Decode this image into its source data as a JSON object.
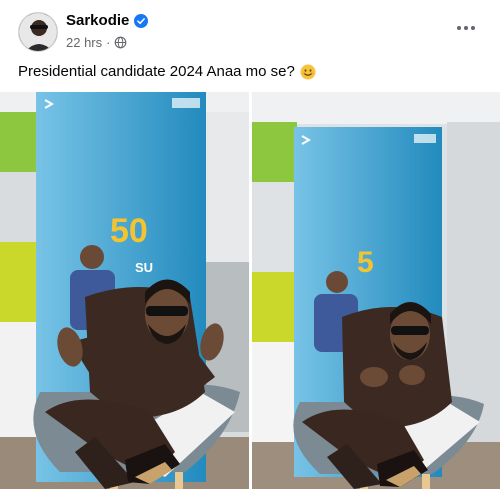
{
  "post": {
    "author": "Sarkodie",
    "time": "22 hrs",
    "audience_icon": "globe-icon",
    "verified_icon": "verified-badge-icon",
    "text": "Presidential candidate 2024 Anaa mo se?",
    "emoji": "smiling-face-emoji",
    "more_icon": "more-options-icon"
  },
  "photos": [
    {
      "name": "photo-left",
      "banner_text": "50",
      "banner_sub": "SU"
    },
    {
      "name": "photo-right",
      "banner_text": "5",
      "banner_sub": ""
    }
  ],
  "colors": {
    "verified": "#1877f2",
    "banner": "#2fa3d9",
    "outfit": "#3c2a22",
    "wall_green": "#8dc63f"
  }
}
